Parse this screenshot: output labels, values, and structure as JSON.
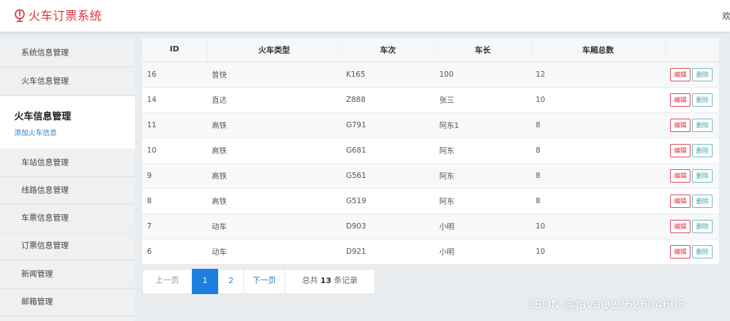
{
  "header": {
    "logo_icon": "train-logo-icon",
    "title": "火车订票系统",
    "user_text": "欢"
  },
  "sidebar": {
    "items_top": [
      {
        "label": "系统信息管理"
      },
      {
        "label": "火车信息管理"
      }
    ],
    "active": {
      "title": "火车信息管理",
      "sub_label": "添加火车信息"
    },
    "items_bottom": [
      {
        "label": "车站信息管理"
      },
      {
        "label": "线路信息管理"
      },
      {
        "label": "车票信息管理"
      },
      {
        "label": "订票信息管理"
      },
      {
        "label": "新闻管理"
      },
      {
        "label": "邮箱管理"
      }
    ]
  },
  "table": {
    "columns": [
      "ID",
      "火车类型",
      "车次",
      "车长",
      "车厢总数",
      ""
    ],
    "edit_label": "编辑",
    "delete_label": "删除",
    "rows": [
      {
        "id": "16",
        "type": "普快",
        "number": "K165",
        "leader": "100",
        "carriages": "12"
      },
      {
        "id": "14",
        "type": "直达",
        "number": "Z888",
        "leader": "张三",
        "carriages": "10"
      },
      {
        "id": "11",
        "type": "高铁",
        "number": "G791",
        "leader": "阿东1",
        "carriages": "8"
      },
      {
        "id": "10",
        "type": "高铁",
        "number": "G681",
        "leader": "阿东",
        "carriages": "8"
      },
      {
        "id": "9",
        "type": "高铁",
        "number": "G561",
        "leader": "阿东",
        "carriages": "8"
      },
      {
        "id": "8",
        "type": "高铁",
        "number": "G519",
        "leader": "阿东",
        "carriages": "8"
      },
      {
        "id": "7",
        "type": "动车",
        "number": "D903",
        "leader": "小明",
        "carriages": "10"
      },
      {
        "id": "6",
        "type": "动车",
        "number": "D921",
        "leader": "小明",
        "carriages": "10"
      }
    ]
  },
  "pagination": {
    "prev": "上一页",
    "pages": [
      "1",
      "2"
    ],
    "current": "1",
    "next": "下一页",
    "total_prefix": "总共",
    "total_count": "13",
    "total_suffix": "条记录"
  },
  "watermark": "CSDN @JavaQ2262604603",
  "colors": {
    "brand_red": "#d9363e",
    "link_blue": "#2f7fc1",
    "page_active": "#1a7fe0",
    "delete_teal": "#4aa3ab"
  }
}
